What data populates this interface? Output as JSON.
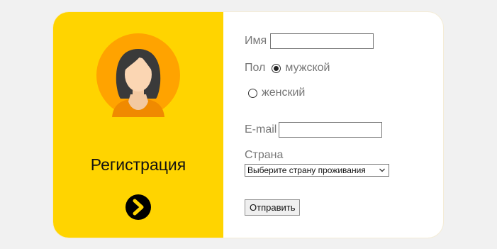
{
  "registration": {
    "title": "Регистрация",
    "avatar_icon": "user-avatar-female-icon",
    "next_icon": "chevron-right-circle-icon",
    "panel_color": "#ffd400"
  },
  "form": {
    "name_label": "Имя",
    "name_value": "",
    "gender_label": "Пол",
    "gender_options": [
      {
        "label": "мужской",
        "checked": true
      },
      {
        "label": "женский",
        "checked": false
      }
    ],
    "email_label": "E-mail",
    "email_value": "",
    "country_label": "Страна",
    "country_selected": "Выберите страну проживания",
    "submit_label": "Отправить"
  }
}
